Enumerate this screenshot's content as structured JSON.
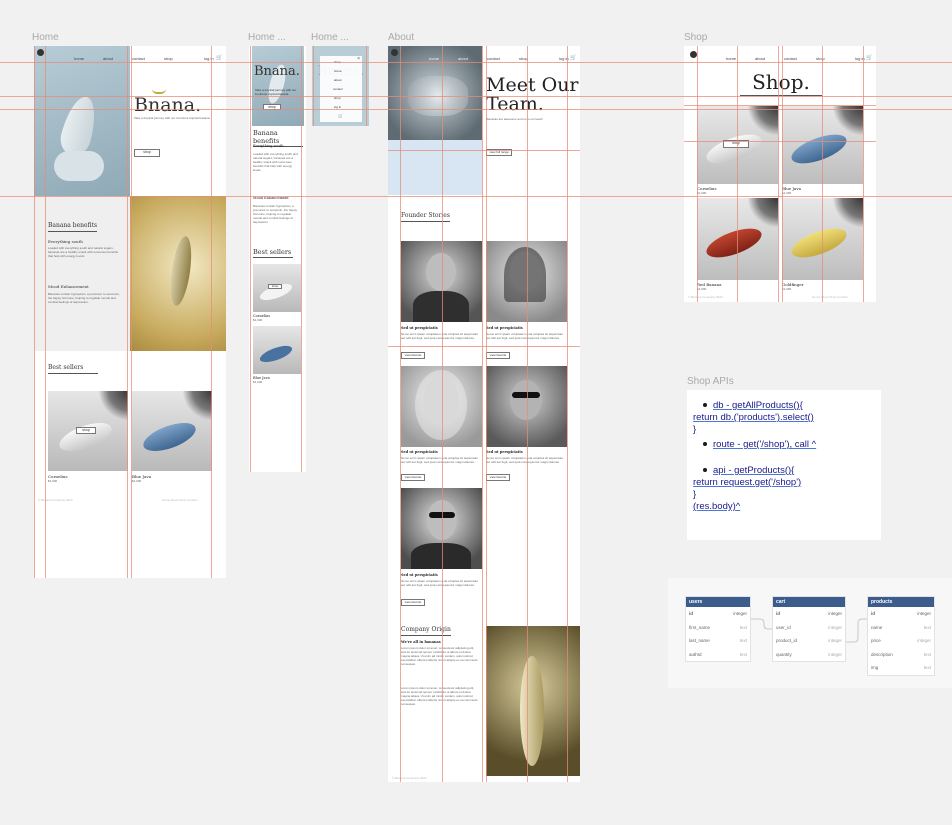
{
  "frames": {
    "home": "Home",
    "home2": "Home ...",
    "home3": "Home ...",
    "about": "About",
    "shop": "Shop",
    "shop_apis": "Shop APIs"
  },
  "nav": {
    "home": "home",
    "about": "about",
    "contact": "contact",
    "shop": "shop",
    "login": "log in"
  },
  "home": {
    "brand": "Bnana.",
    "tagline": "Take a tropical journey with our luxurious tropical banana.",
    "shop_btn": "shop",
    "benefits_title": "Banana benefits",
    "benefit1_title": "Everything south",
    "benefit1_text": "Loaded with everything south and natural sugars, bananas are a healthy snack with numerous benefits that help with energy levels.",
    "benefit2_title": "Mood Enhancement",
    "benefit2_text": "Bananas contain tryptophan, a precursor to serotonin, the happy hormone, helping to regulate moods and combat feelings of depression.",
    "best_sellers": "Best sellers",
    "product1_name": "Cornelius",
    "product1_price": "$1,000",
    "product2_name": "Blue Java",
    "product2_price": "$1,000",
    "footer": "© Banana Company 2024",
    "footer_links": "Home   About   Shop   Contact"
  },
  "mobile_menu": [
    "shop",
    "home",
    "about",
    "contact",
    "shop",
    "log in"
  ],
  "about": {
    "title_line1": "Meet Our",
    "title_line2": "Team.",
    "subtitle": "Bananas are awesome and so is our team!",
    "learn_btn": "view full range",
    "founder_title": "Founder Stories",
    "person_title": "Sed ut perspiciatis",
    "person_text": "Nemo enim ipsam voluptatem quia voluptas sit aspernatur aut odit aut fugit, sed quia consequuntur magni dolores.",
    "person_btn": "view favorite",
    "origin_title": "Company Origin",
    "origin_sub": "We're all in bananas",
    "origin_text": "Lorem ipsum dolor sit amet, consectetur adipiscing elit, sed do eiusmod tempor incididunt ut labore et dolore magna aliqua. Ut enim ad minim veniam, quis nostrud exercitation ullamco laboris nisi ut aliquip ex ea commodo consequat."
  },
  "shop": {
    "title": "Shop.",
    "shop_btn": "shop",
    "products": [
      {
        "name": "Cornelius",
        "price": "$1,000"
      },
      {
        "name": "Blue Java",
        "price": "$1,000"
      },
      {
        "name": "Red Banana",
        "price": "$1,000"
      },
      {
        "name": "Goldfinger",
        "price": "$1,000"
      }
    ],
    "footer": "© Banana Company 2024"
  },
  "apis": [
    {
      "lines": [
        "db - getAllProducts(){",
        "return db.('products').select()",
        "}"
      ]
    },
    {
      "lines": [
        "route - get('/shop'), call ^"
      ]
    },
    {
      "lines": [
        "api - getProducts(){",
        "return request.get('/shop')",
        "}",
        "(res.body)^"
      ]
    }
  ],
  "db": {
    "users": {
      "name": "users",
      "rows": [
        [
          "id",
          "integer"
        ],
        [
          "first_name",
          "text"
        ],
        [
          "last_name",
          "text"
        ],
        [
          "authId",
          "text"
        ]
      ]
    },
    "cart": {
      "name": "cart",
      "rows": [
        [
          "id",
          "integer"
        ],
        [
          "user_id",
          "integer"
        ],
        [
          "product_id",
          "integer"
        ],
        [
          "quantity",
          "integer"
        ]
      ]
    },
    "products": {
      "name": "products",
      "rows": [
        [
          "id",
          "integer"
        ],
        [
          "name",
          "text"
        ],
        [
          "price",
          "integer"
        ],
        [
          "description",
          "text"
        ],
        [
          "img",
          "text"
        ]
      ]
    }
  },
  "colors": {
    "guide": "#e68c78",
    "db_header": "#3b5c8c",
    "link": "#1a1a8a",
    "hero_blue": "#9fb8c4",
    "banana_yellow": "#d9c27a"
  }
}
